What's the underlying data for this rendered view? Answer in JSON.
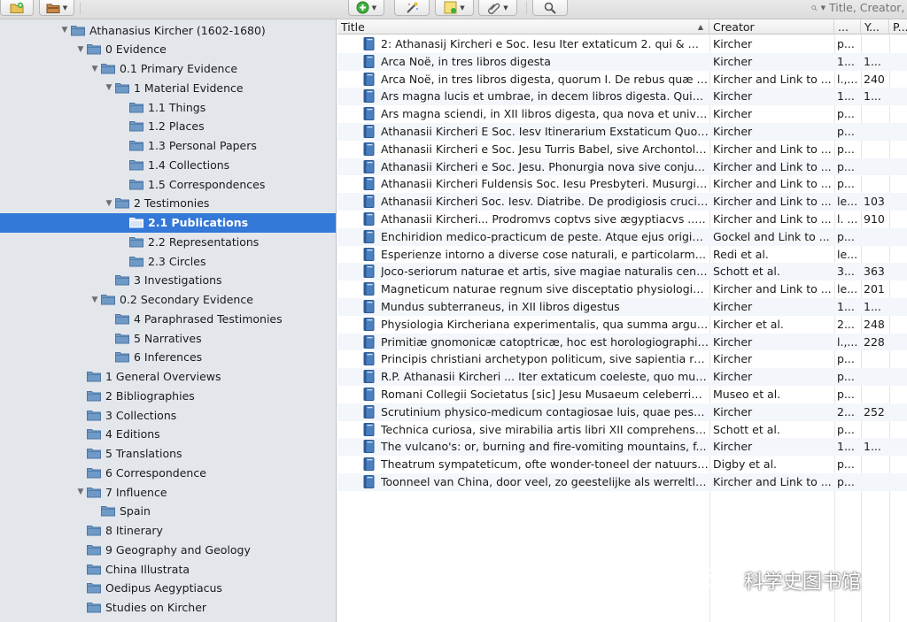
{
  "toolbar": {
    "buttons": [
      {
        "name": "new-collection-button",
        "icon": "folder-plus-icon"
      },
      {
        "name": "collection-actions-button",
        "icon": "folder-gear-icon"
      },
      {
        "name": "new-item-button",
        "icon": "green-plus-icon"
      },
      {
        "name": "magic-wand-button",
        "icon": "wand-icon"
      },
      {
        "name": "new-note-button",
        "icon": "note-icon"
      },
      {
        "name": "attachment-button",
        "icon": "paperclip-icon"
      },
      {
        "name": "advanced-search-button",
        "icon": "magnifier-icon"
      }
    ],
    "search_placeholder": "Title, Creator, Year"
  },
  "sidebar": {
    "nodes": [
      {
        "label": "Athanasius Kircher (1602-1680)",
        "depth": 0,
        "expanded": true
      },
      {
        "label": "0 Evidence",
        "depth": 1,
        "expanded": true
      },
      {
        "label": "0.1 Primary Evidence",
        "depth": 2,
        "expanded": true
      },
      {
        "label": "1 Material Evidence",
        "depth": 3,
        "expanded": true
      },
      {
        "label": "1.1 Things",
        "depth": 4
      },
      {
        "label": "1.2 Places",
        "depth": 4
      },
      {
        "label": "1.3 Personal Papers",
        "depth": 4
      },
      {
        "label": "1.4 Collections",
        "depth": 4
      },
      {
        "label": "1.5 Correspondences",
        "depth": 4
      },
      {
        "label": "2 Testimonies",
        "depth": 3,
        "expanded": true
      },
      {
        "label": "2.1 Publications",
        "depth": 4,
        "selected": true
      },
      {
        "label": "2.2 Representations",
        "depth": 4
      },
      {
        "label": "2.3 Circles",
        "depth": 4
      },
      {
        "label": "3 Investigations",
        "depth": 3
      },
      {
        "label": "0.2 Secondary Evidence",
        "depth": 2,
        "expanded": true
      },
      {
        "label": "4 Paraphrased Testimonies",
        "depth": 3
      },
      {
        "label": "5 Narratives",
        "depth": 3
      },
      {
        "label": "6 Inferences",
        "depth": 3
      },
      {
        "label": "1 General Overviews",
        "depth": 1
      },
      {
        "label": "2 Bibliographies",
        "depth": 1
      },
      {
        "label": "3 Collections",
        "depth": 1
      },
      {
        "label": "4 Editions",
        "depth": 1
      },
      {
        "label": "5 Translations",
        "depth": 1
      },
      {
        "label": "6 Correspondence",
        "depth": 1
      },
      {
        "label": "7 Influence",
        "depth": 1,
        "expanded": true
      },
      {
        "label": "Spain",
        "depth": 2
      },
      {
        "label": "8 Itinerary",
        "depth": 1
      },
      {
        "label": "9 Geography and Geology",
        "depth": 1
      },
      {
        "label": "China Illustrata",
        "depth": 1
      },
      {
        "label": "Oedipus Aegyptiacus",
        "depth": 1
      },
      {
        "label": "Studies on Kircher",
        "depth": 1
      }
    ]
  },
  "items": {
    "columns": {
      "title": "Title",
      "creator": "Creator",
      "date": "...",
      "year": "Y...",
      "pages": "P..."
    },
    "rows": [
      {
        "title": "2: Athanasij Kircheri e Soc. Iesu Iter extaticum 2. qui & mu...",
        "creator": "Kircher",
        "date": "p...",
        "year": ""
      },
      {
        "title": "Arca Noë, in tres libros digesta",
        "creator": "Kircher",
        "date": "1...",
        "year": "1..."
      },
      {
        "title": "Arca Noë, in tres libros digesta, quorum I. De rebus quæ a...",
        "creator": "Kircher and Link to ...",
        "date": "l.,...",
        "year": "240"
      },
      {
        "title": "Ars magna lucis et umbrae, in decem libros digesta. Quib...",
        "creator": "Kircher",
        "date": "1...",
        "year": "1..."
      },
      {
        "title": "Ars magna sciendi, in XII libros digesta, qua nova et unive...",
        "creator": "Kircher",
        "date": "p...",
        "year": ""
      },
      {
        "title": "Athanasii Kircheri E Soc. Iesv Itinerarium Exstaticum Quo ...",
        "creator": "Kircher",
        "date": "p...",
        "year": ""
      },
      {
        "title": "Athanasii Kircheri e Soc. Jesu Turris Babel, sive Archontolo...",
        "creator": "Kircher and Link to ...",
        "date": "p...",
        "year": ""
      },
      {
        "title": "Athanasii Kircheri e Soc. Jesu. Phonurgia nova sive conjugi...",
        "creator": "Kircher and Link to ...",
        "date": "p...",
        "year": ""
      },
      {
        "title": "Athanasii Kircheri Fuldensis Soc. Iesu Presbyteri. Musurgia...",
        "creator": "Kircher and Link to ...",
        "date": "p...",
        "year": ""
      },
      {
        "title": "Athanasii Kircheri Soc. Iesv. Diatribe. De prodigiosis crucib...",
        "creator": "Kircher and Link to ...",
        "date": "le...",
        "year": "103"
      },
      {
        "title": "Athanasii Kircheri... Prodromvs coptvs sive ægyptiacvs ... i...",
        "creator": "Kircher and Link to ...",
        "date": "l. ...",
        "year": "910"
      },
      {
        "title": "Enchiridion medico-practicum de peste. Atque ejus origin...",
        "creator": "Gockel and Link to ...",
        "date": "p...",
        "year": ""
      },
      {
        "title": "Esperienze intorno a diverse cose naturali, e particolarmen...",
        "creator": "Redi et al.",
        "date": "le...",
        "year": ""
      },
      {
        "title": "Joco-seriorum naturae et artis, sive magiae naturalis cent...",
        "creator": "Schott et al.",
        "date": "3...",
        "year": "363"
      },
      {
        "title": "Magneticum naturae regnum sive disceptatio physiologica...",
        "creator": "Kircher and Link to ...",
        "date": "le...",
        "year": "201"
      },
      {
        "title": "Mundus subterraneus, in XII libros digestus",
        "creator": "Kircher",
        "date": "1...",
        "year": "1..."
      },
      {
        "title": "Physiologia Kircheriana experimentalis, qua summa argum...",
        "creator": "Kircher et al.",
        "date": "2...",
        "year": "248"
      },
      {
        "title": "Primitiæ gnomonicæ catoptricæ, hoc est horologiographiæ...",
        "creator": "Kircher",
        "date": "l.,...",
        "year": "228"
      },
      {
        "title": "Principis christiani archetypon politicum, sive sapientia re...",
        "creator": "Kircher",
        "date": "p...",
        "year": ""
      },
      {
        "title": "R.P. Athanasii Kircheri ... Iter extaticum coeleste, quo mun...",
        "creator": "Kircher",
        "date": "p...",
        "year": ""
      },
      {
        "title": "Romani Collegii Societatus [sic] Jesu Musaeum celeberrimu...",
        "creator": "Museo et al.",
        "date": "p...",
        "year": ""
      },
      {
        "title": "Scrutinium physico-medicum contagiosae luis, quae pesti...",
        "creator": "Kircher",
        "date": "2...",
        "year": "252"
      },
      {
        "title": "Technica curiosa, sive mirabilia artis libri XII comprehensa....",
        "creator": "Schott et al.",
        "date": "p...",
        "year": ""
      },
      {
        "title": "The vulcano's: or, burning and fire-vomiting mountains, f...",
        "creator": "Kircher",
        "date": "1...",
        "year": "1..."
      },
      {
        "title": "Theatrum sympateticum, ofte wonder-toneel der natuurs ...",
        "creator": "Digby et al.",
        "date": "p...",
        "year": ""
      },
      {
        "title": "Toonneel van China, door veel, zo geestelijke als werreltlij...",
        "creator": "Kircher and Link to ...",
        "date": "p...",
        "year": ""
      }
    ]
  },
  "watermark": {
    "text": "科学史图书馆"
  },
  "colors": {
    "selection": "#3478d8",
    "sidebar_bg": "#e3e7ec",
    "folder": "#6f99c6",
    "row_alt": "#f3f6fa"
  }
}
